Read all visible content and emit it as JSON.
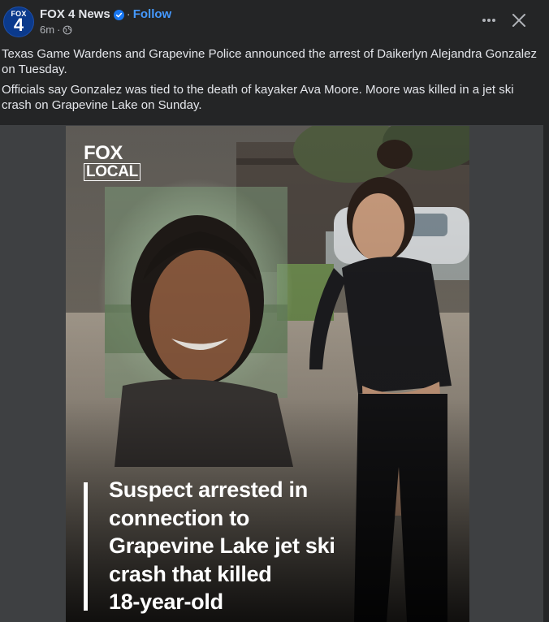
{
  "header": {
    "avatar_top": "FOX",
    "avatar_number": "4",
    "page_name": "FOX 4 News",
    "separator": "·",
    "follow_label": "Follow",
    "timestamp": "6m",
    "audience_icon": "globe-icon",
    "more_icon": "more-icon",
    "close_icon": "close-icon"
  },
  "caption": {
    "paragraphs": [
      "Texas Game Wardens and Grapevine Police announced the arrest of Daikerlyn Alejandra Gonzalez on Tuesday.",
      "Officials say Gonzalez was tied to the death of kayaker Ava Moore. Moore was killed in a jet ski crash on Grapevine Lake on Sunday."
    ]
  },
  "media": {
    "logo_line1": "FOX",
    "logo_line2": "LOCAL",
    "headline_lines": [
      "Suspect arrested in",
      "connection to",
      "Grapevine Lake jet ski",
      "crash that killed",
      "18-year-old"
    ]
  },
  "colors": {
    "background": "#242526",
    "text": "#e4e6eb",
    "secondary_text": "#b0b3b8",
    "follow": "#4599ff",
    "verified": "#1877f2",
    "media_frame": "#3e4042"
  }
}
